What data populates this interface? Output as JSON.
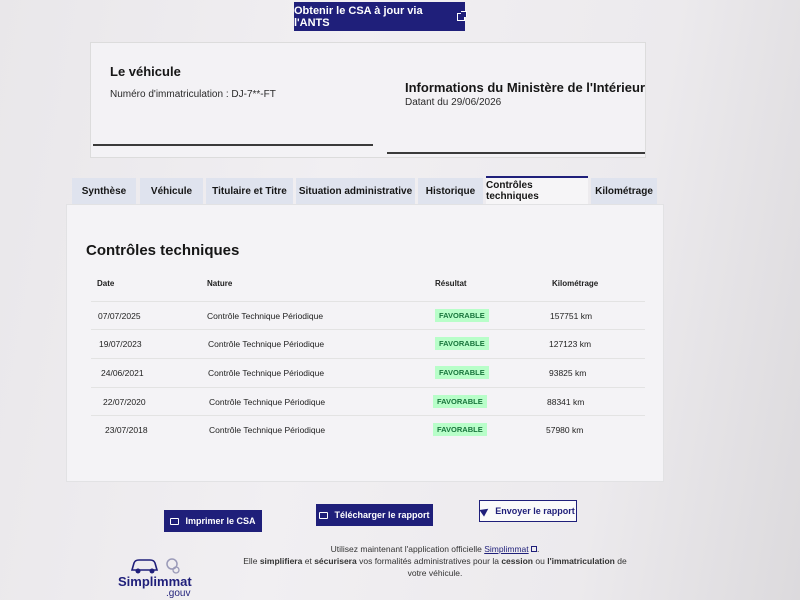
{
  "header": {
    "ants_button_label": "Obtenir le CSA à jour via l'ANTS"
  },
  "vehicle": {
    "title": "Le véhicule",
    "registration": "Numéro d'immatriculation : DJ-7**-FT"
  },
  "ministry": {
    "title": "Informations du Ministère de l'Intérieur",
    "date": "Datant du 29/06/2026"
  },
  "tabs": [
    {
      "label": "Synthèse"
    },
    {
      "label": "Véhicule"
    },
    {
      "label": "Titulaire et Titre"
    },
    {
      "label": "Situation administrative"
    },
    {
      "label": "Historique"
    },
    {
      "label": "Contrôles techniques",
      "active": true
    },
    {
      "label": "Kilométrage"
    }
  ],
  "section": {
    "title": "Contrôles techniques",
    "columns": [
      "Date",
      "Nature",
      "Résultat",
      "Kilométrage"
    ],
    "rows": [
      {
        "date": "07/07/2025",
        "nature": "Contrôle Technique Périodique",
        "result": "FAVORABLE",
        "km": "157751 km"
      },
      {
        "date": "19/07/2023",
        "nature": "Contrôle Technique Périodique",
        "result": "FAVORABLE",
        "km": "127123 km"
      },
      {
        "date": "24/06/2021",
        "nature": "Contrôle Technique Périodique",
        "result": "FAVORABLE",
        "km": "93825 km"
      },
      {
        "date": "22/07/2020",
        "nature": "Contrôle Technique Périodique",
        "result": "FAVORABLE",
        "km": "88341 km"
      },
      {
        "date": "23/07/2018",
        "nature": "Contrôle Technique Périodique",
        "result": "FAVORABLE",
        "km": "57980 km"
      }
    ]
  },
  "actions": {
    "print": "Imprimer le CSA",
    "download": "Télécharger le rapport",
    "send": "Envoyer le rapport"
  },
  "promo": {
    "line1_prefix": "Utilisez maintenant l'application officielle",
    "app_link": "Simplimmat",
    "line2_a": "Elle",
    "line2_b": "simplifiera",
    "line2_c": "et",
    "line2_d": "sécurisera",
    "line2_e": "vos formalités administratives pour la",
    "line2_f": "cession",
    "line2_g": "ou",
    "line2_h": "l'immatriculation",
    "line2_i": "de votre véhicule."
  },
  "logo": {
    "word": "Simplimmat",
    "sub": ".gouv"
  },
  "colors": {
    "brand": "#1f1f7a",
    "success_bg": "#b8fec9",
    "success_text": "#18753c"
  }
}
